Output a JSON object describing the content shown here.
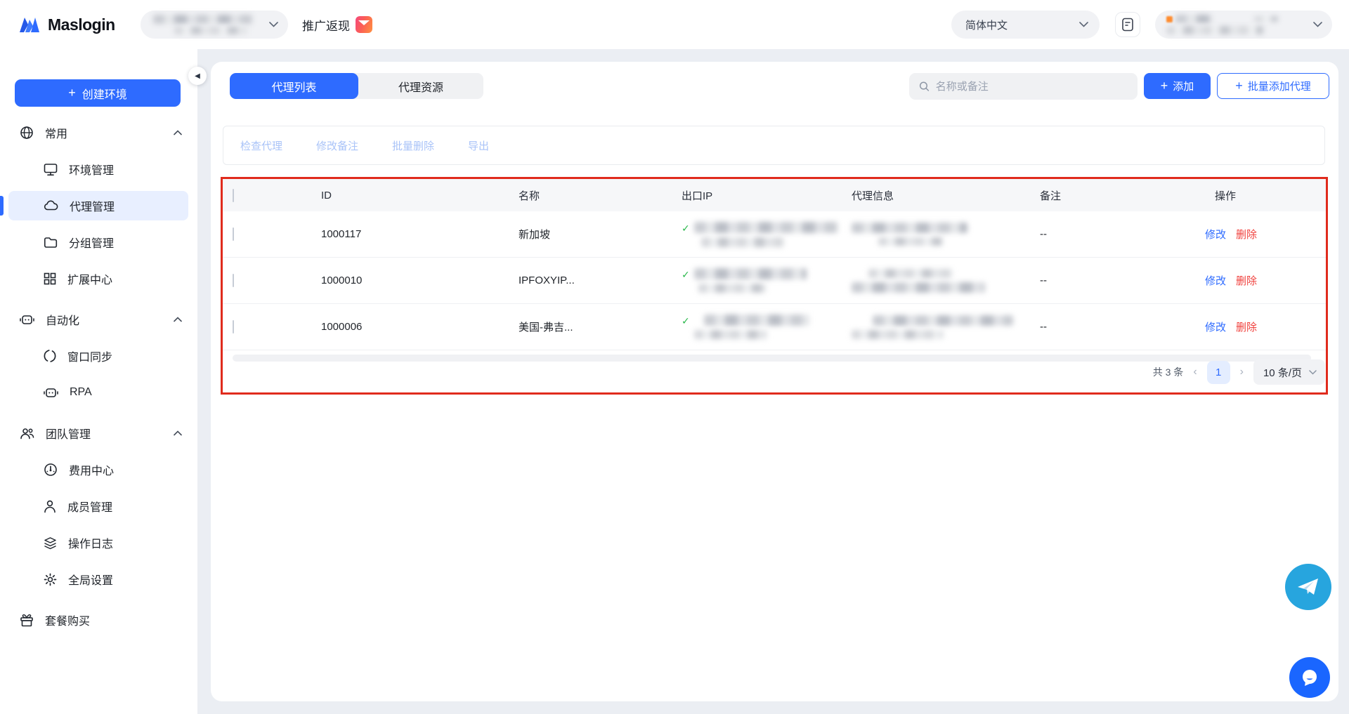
{
  "colors": {
    "primary": "#2E6BFF",
    "primary_light_bg": "#E8EFFF",
    "disabled_link": "#A9C3F8",
    "danger": "#F0413D",
    "success": "#2BB84C",
    "annotation_red": "#E02B1D",
    "telegram": "#27A5DE",
    "chat": "#1A66FF",
    "page_bg": "#EBEEF3"
  },
  "topbar": {
    "logo_text": "Maslogin",
    "env_selector_masked": true,
    "promo_label": "推广返现",
    "language_label": "简体中文",
    "user_account_masked": true
  },
  "sidebar": {
    "create_label": "创建环境",
    "groups": [
      {
        "label": "常用",
        "items": [
          {
            "label": "环境管理"
          },
          {
            "label": "代理管理",
            "active": true
          },
          {
            "label": "分组管理"
          },
          {
            "label": "扩展中心"
          }
        ]
      },
      {
        "label": "自动化",
        "items": [
          {
            "label": "窗口同步"
          },
          {
            "label": "RPA"
          }
        ]
      },
      {
        "label": "团队管理",
        "items": [
          {
            "label": "费用中心"
          },
          {
            "label": "成员管理"
          },
          {
            "label": "操作日志"
          },
          {
            "label": "全局设置"
          }
        ]
      }
    ],
    "purchase_label": "套餐购买"
  },
  "main": {
    "tabs": [
      {
        "label": "代理列表",
        "active": true
      },
      {
        "label": "代理资源",
        "active": false
      }
    ],
    "search_placeholder": "名称或备注",
    "add_label": "添加",
    "bulk_add_label": "批量添加代理",
    "toolbar": [
      {
        "label": "检查代理"
      },
      {
        "label": "修改备注"
      },
      {
        "label": "批量删除"
      },
      {
        "label": "导出"
      }
    ],
    "table": {
      "columns": [
        "ID",
        "名称",
        "出口IP",
        "代理信息",
        "备注",
        "操作"
      ],
      "edit_label": "修改",
      "delete_label": "删除",
      "rows": [
        {
          "id": "1000117",
          "name": "新加坡",
          "remark": "--",
          "exit_ip_masked": true,
          "proxy_info_masked": true,
          "checked": false
        },
        {
          "id": "1000010",
          "name": "IPFOXYIP...",
          "remark": "--",
          "exit_ip_masked": true,
          "proxy_info_masked": true,
          "checked": false
        },
        {
          "id": "1000006",
          "name": "美国-弗吉...",
          "remark": "--",
          "exit_ip_masked": true,
          "proxy_info_masked": true,
          "checked": false
        }
      ]
    },
    "pagination": {
      "total": "共 3 条",
      "page": "1",
      "page_size": "10 条/页"
    }
  }
}
